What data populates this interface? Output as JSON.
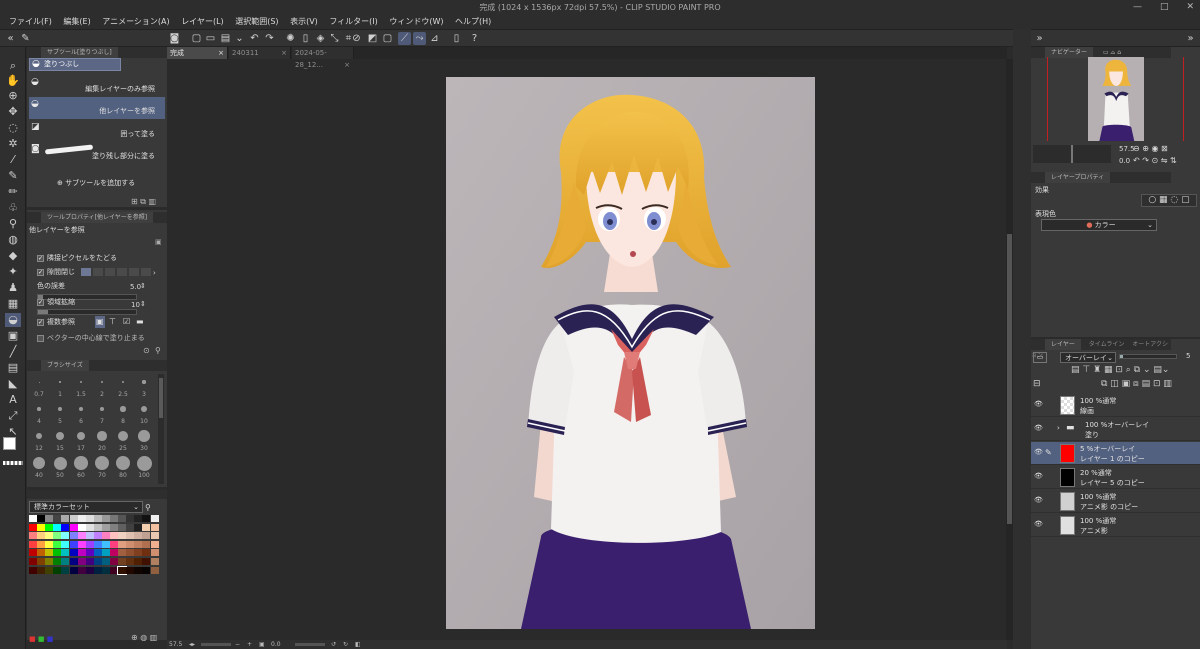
{
  "title": "完成 (1024 x 1536px 72dpi 57.5%) - CLIP STUDIO PAINT PRO",
  "window_controls": [
    "—",
    "□",
    "✕"
  ],
  "menu": [
    "ファイル(F)",
    "編集(E)",
    "アニメーション(A)",
    "レイヤー(L)",
    "選択範囲(S)",
    "表示(V)",
    "フィルター(I)",
    "ウィンドウ(W)",
    "ヘルプ(H)"
  ],
  "subtool": {
    "tab": "サブツール[塗りつぶし]",
    "group": "塗りつぶし",
    "items": [
      {
        "label": "編集レイヤーのみ参照",
        "icon": "bucket-icon",
        "selected": false
      },
      {
        "label": "他レイヤーを参照",
        "icon": "bucket-icon",
        "selected": true
      },
      {
        "label": "囲って塗る",
        "icon": "lasso-fill-icon",
        "selected": false
      },
      {
        "label": "塗り残し部分に塗る",
        "icon": "brush-fill-icon",
        "selected": false
      }
    ],
    "add_label": "サブツールを追加する"
  },
  "toolprop": {
    "tab": "ツールプロパティ[他レイヤーを参照]",
    "title": "他レイヤーを参照",
    "rows": [
      {
        "label": "隣接ピクセルをたどる",
        "checked": true
      },
      {
        "label": "隙間閉じ",
        "checked": true
      },
      {
        "label": "色の誤差",
        "value": "5.0"
      },
      {
        "label": "領域拡縮",
        "checked": true,
        "value": "10"
      },
      {
        "label": "複数参照",
        "checked": true
      },
      {
        "label": "ベクターの中心線で塗り止まる",
        "checked": false
      }
    ],
    "tolerance_fraction": 0.05,
    "expand_fraction": 0.1
  },
  "brushsize": {
    "tab": "ブラシサイズ",
    "labels": [
      "0.7",
      "1",
      "1.5",
      "2",
      "2.5",
      "3",
      "4",
      "5",
      "6",
      "7",
      "8",
      "10",
      "12",
      "15",
      "17",
      "20",
      "25",
      "30",
      "40",
      "50",
      "60",
      "70",
      "80",
      "100"
    ]
  },
  "colorset": {
    "name": "標準カラーセット"
  },
  "doc_tabs": [
    "完成",
    "240311",
    "2024-05-28_12..."
  ],
  "status": {
    "zoom": "57.5",
    "rotation": "0.0"
  },
  "navigator": {
    "tab": "ナビゲーター",
    "zoom": "57.5",
    "rotation": "0.0"
  },
  "layerprop": {
    "tab": "レイヤープロパティ",
    "effect_label": "効果",
    "expression_label": "表現色",
    "expression_value": "カラー"
  },
  "layers": {
    "tabs": [
      "レイヤー",
      "タイムライン",
      "オートアクション"
    ],
    "blend_mode": "オーバーレイ",
    "opacity": "5",
    "rows": [
      {
        "mode": "100 %通常",
        "name": "線画",
        "thumb": "#e8e8e8",
        "selected": false,
        "folder": false
      },
      {
        "mode": "100 %オーバーレイ",
        "name": "塗り",
        "thumb": "",
        "selected": false,
        "folder": true
      },
      {
        "mode": "5 %オーバーレイ",
        "name": "レイヤー 1 のコピー",
        "thumb": "#ff0000",
        "selected": true,
        "folder": false
      },
      {
        "mode": "20 %通常",
        "name": "レイヤー 5 のコピー",
        "thumb": "#000000",
        "selected": false,
        "folder": false
      },
      {
        "mode": "100 %通常",
        "name": "アニメ影 のコピー",
        "thumb": "#d0d0d0",
        "selected": false,
        "folder": false
      },
      {
        "mode": "100 %通常",
        "name": "アニメ影",
        "thumb": "#e0e0e0",
        "selected": false,
        "folder": false
      }
    ]
  }
}
